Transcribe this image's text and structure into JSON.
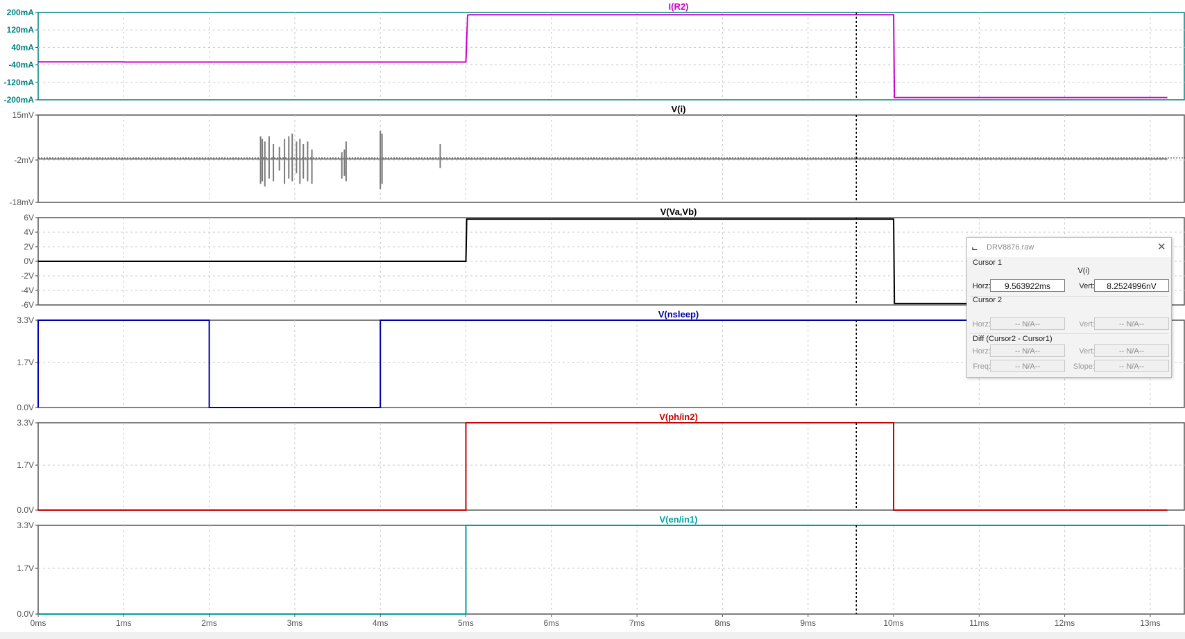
{
  "chart_data": [
    {
      "type": "line",
      "title": "I(R2)",
      "title_color": "#cc00cc",
      "axis_color": "#008080",
      "series": [
        {
          "name": "I(R2)",
          "color": "#cc00cc",
          "x": [
            0,
            1,
            1.01,
            5,
            5.02,
            5.05,
            10,
            10.01,
            13.2
          ],
          "y": [
            -26,
            -26,
            -27,
            -27,
            188,
            190,
            190,
            -190,
            -190
          ]
        }
      ],
      "ylim": [
        -200,
        200
      ],
      "yticks": [
        200,
        120,
        40,
        -40,
        -120,
        -200
      ],
      "ytick_labels": [
        "200mA",
        "120mA",
        "40mA",
        "-40mA",
        "-120mA",
        "-200mA"
      ],
      "xlim": [
        0,
        13.2
      ],
      "grid": true
    },
    {
      "type": "line",
      "title": "V(i)",
      "title_color": "#000000",
      "axis_color": "#555555",
      "series": [
        {
          "name": "V(i)",
          "color": "#808080",
          "baseline": -1.6,
          "spike_color": "#7a7a7a",
          "x": [
            0,
            13.2
          ],
          "y": [
            -1.6,
            -1.6
          ]
        }
      ],
      "spikes": [
        {
          "x": 2.6,
          "y0": -11,
          "y1": 7
        },
        {
          "x": 2.62,
          "y0": -10,
          "y1": 6
        },
        {
          "x": 2.65,
          "y0": -12,
          "y1": 5
        },
        {
          "x": 2.7,
          "y0": -9,
          "y1": 7
        },
        {
          "x": 2.75,
          "y0": -10,
          "y1": 4
        },
        {
          "x": 2.82,
          "y0": -6,
          "y1": 3
        },
        {
          "x": 2.88,
          "y0": -11,
          "y1": 6
        },
        {
          "x": 2.93,
          "y0": -9,
          "y1": 7
        },
        {
          "x": 2.97,
          "y0": -10,
          "y1": 8
        },
        {
          "x": 3.02,
          "y0": -7,
          "y1": 5
        },
        {
          "x": 3.06,
          "y0": -11,
          "y1": 6
        },
        {
          "x": 3.1,
          "y0": -9,
          "y1": 4
        },
        {
          "x": 3.15,
          "y0": -10,
          "y1": 5
        },
        {
          "x": 3.2,
          "y0": -11,
          "y1": 2
        },
        {
          "x": 3.55,
          "y0": -9,
          "y1": 1
        },
        {
          "x": 3.58,
          "y0": -8,
          "y1": 2
        },
        {
          "x": 3.6,
          "y0": -10,
          "y1": 5
        },
        {
          "x": 4.0,
          "y0": -13,
          "y1": 9
        },
        {
          "x": 4.02,
          "y0": -11,
          "y1": 8
        },
        {
          "x": 4.7,
          "y0": -5,
          "y1": 4
        }
      ],
      "ylim": [
        -18,
        15
      ],
      "yticks": [
        15,
        -2,
        -18
      ],
      "ytick_labels": [
        "15mV",
        "-2mV",
        "-18mV"
      ],
      "xlim": [
        0,
        13.2
      ],
      "grid": true
    },
    {
      "type": "line",
      "title": "V(Va,Vb)",
      "title_color": "#000000",
      "axis_color": "#555555",
      "series": [
        {
          "name": "V(Va,Vb)",
          "color": "#000000",
          "x": [
            0,
            5,
            5.01,
            10,
            10.01,
            10.05,
            13.2
          ],
          "y": [
            0,
            0,
            5.8,
            5.8,
            -5.8,
            -5.8,
            -5.8
          ]
        }
      ],
      "ylim": [
        -6,
        6
      ],
      "yticks": [
        6,
        4,
        2,
        0,
        -2,
        -4,
        -6
      ],
      "ytick_labels": [
        "6V",
        "4V",
        "2V",
        "0V",
        "-2V",
        "-4V",
        "-6V"
      ],
      "xlim": [
        0,
        13.2
      ],
      "grid": true
    },
    {
      "type": "line",
      "title": "V(nsleep)",
      "title_color": "#0000aa",
      "axis_color": "#555555",
      "series": [
        {
          "name": "V(nsleep)",
          "color": "#0000aa",
          "x": [
            0,
            0,
            2,
            2,
            4,
            4,
            13.2
          ],
          "y": [
            0,
            3.3,
            3.3,
            0,
            0,
            3.3,
            3.3
          ]
        }
      ],
      "ylim": [
        0,
        3.3
      ],
      "yticks": [
        3.3,
        1.7,
        0
      ],
      "ytick_labels": [
        "3.3V",
        "1.7V",
        "0.0V"
      ],
      "xlim": [
        0,
        13.2
      ],
      "grid": true
    },
    {
      "type": "line",
      "title": "V(ph/in2)",
      "title_color": "#cc0000",
      "axis_color": "#555555",
      "series": [
        {
          "name": "V(ph/in2)",
          "color": "#cc0000",
          "x": [
            0,
            5,
            5,
            10,
            10,
            13.2
          ],
          "y": [
            0,
            0,
            3.3,
            3.3,
            0,
            0
          ]
        }
      ],
      "ylim": [
        0,
        3.3
      ],
      "yticks": [
        3.3,
        1.7,
        0
      ],
      "ytick_labels": [
        "3.3V",
        "1.7V",
        "0.0V"
      ],
      "xlim": [
        0,
        13.2
      ],
      "grid": true
    },
    {
      "type": "line",
      "title": "V(en/in1)",
      "title_color": "#00a0a0",
      "axis_color": "#555555",
      "series": [
        {
          "name": "V(en/in1)",
          "color": "#00a0a0",
          "x": [
            0,
            5,
            5,
            13.2
          ],
          "y": [
            0,
            0,
            3.3,
            3.3
          ]
        }
      ],
      "ylim": [
        0,
        3.3
      ],
      "yticks": [
        3.3,
        1.7,
        0
      ],
      "ytick_labels": [
        "3.3V",
        "1.7V",
        "0.0V"
      ],
      "xlim": [
        0,
        13.2
      ],
      "grid": true
    }
  ],
  "x_axis": {
    "ticks": [
      0,
      1,
      2,
      3,
      4,
      5,
      6,
      7,
      8,
      9,
      10,
      11,
      12,
      13
    ],
    "tick_labels": [
      "0ms",
      "1ms",
      "2ms",
      "3ms",
      "4ms",
      "5ms",
      "6ms",
      "7ms",
      "8ms",
      "9ms",
      "10ms",
      "11ms",
      "12ms",
      "13ms"
    ]
  },
  "cursor_line": {
    "x": 9.563922
  },
  "cursor_window": {
    "title": "DRV8876.raw",
    "icon": "waveform-icon",
    "cursor1_label": "Cursor 1",
    "cursor1_trace": "V(i)",
    "horz_label": "Horz:",
    "vert_label": "Vert:",
    "cursor1_horz": "9.563922ms",
    "cursor1_vert": "8.2524996nV",
    "cursor2_label": "Cursor 2",
    "cursor2_horz": "-- N/A--",
    "cursor2_vert": "-- N/A--",
    "diff_label": "Diff (Cursor2 - Cursor1)",
    "diff_horz": "-- N/A--",
    "diff_vert": "-- N/A--",
    "freq_label": "Freq:",
    "slope_label": "Slope:",
    "diff_freq": "-- N/A--",
    "diff_slope": "-- N/A--"
  }
}
